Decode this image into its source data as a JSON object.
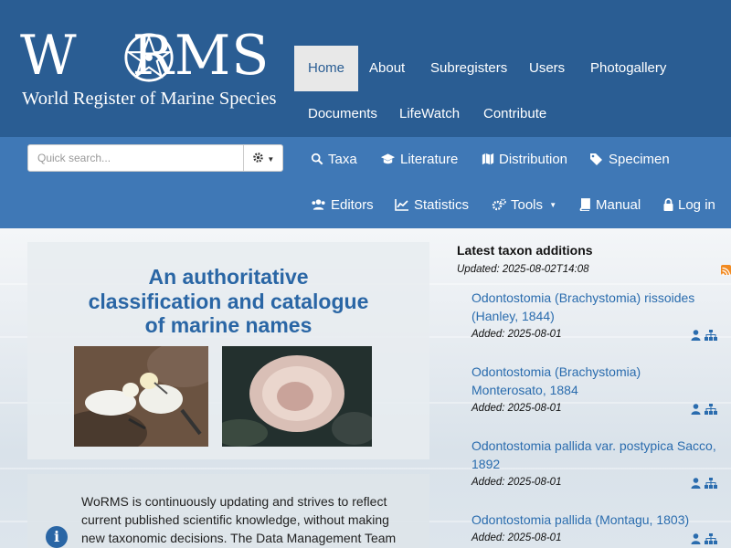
{
  "logo": {
    "word_left": "W",
    "word_right": "RMS",
    "subtitle": "World Register of Marine Species"
  },
  "top_nav": [
    {
      "label": "Home",
      "active": true
    },
    {
      "label": "About"
    },
    {
      "label": "Subregisters"
    },
    {
      "label": "Users"
    },
    {
      "label": "Photogallery"
    },
    {
      "label": "Documents"
    },
    {
      "label": "LifeWatch"
    },
    {
      "label": "Contribute"
    }
  ],
  "search": {
    "placeholder": "Quick search...",
    "options_icon": "gear-icon"
  },
  "sub_nav": [
    {
      "label": "Taxa",
      "icon": "search-icon"
    },
    {
      "label": "Literature",
      "icon": "graduation-cap-icon"
    },
    {
      "label": "Distribution",
      "icon": "map-icon"
    },
    {
      "label": "Specimen",
      "icon": "tags-icon"
    },
    {
      "label": "Editors",
      "icon": "users-icon"
    },
    {
      "label": "Statistics",
      "icon": "line-chart-icon"
    },
    {
      "label": "Tools",
      "icon": "cogs-icon"
    },
    {
      "label": "Manual",
      "icon": "book-icon"
    },
    {
      "label": "Log in",
      "icon": "lock-icon"
    }
  ],
  "main": {
    "tagline": [
      "An authoritative",
      "classification and catalogue",
      "of marine names"
    ],
    "info_text": "WoRMS is continuously updating and strives to reflect current published scientific knowledge, without making new taxonomic decisions. The Data Management Team"
  },
  "latest": {
    "title": "Latest taxon additions",
    "updated": "Updated: 2025-08-02T14:08",
    "items": [
      {
        "name": "Odontostomia (Brachystomia) rissoides (Hanley, 1844)",
        "added": "Added: 2025-08-01"
      },
      {
        "name": "Odontostomia (Brachystomia) Monterosato, 1884",
        "added": "Added: 2025-08-01"
      },
      {
        "name": "Odontostomia pallida var. postypica Sacco, 1892",
        "added": "Added: 2025-08-01"
      },
      {
        "name": "Odontostomia pallida (Montagu, 1803)",
        "added": "Added: 2025-08-01"
      }
    ]
  },
  "colors": {
    "header": "#2a5d93",
    "subnav": "#3f78b6",
    "link": "#2a6cae",
    "tagline": "#2a66a5"
  }
}
